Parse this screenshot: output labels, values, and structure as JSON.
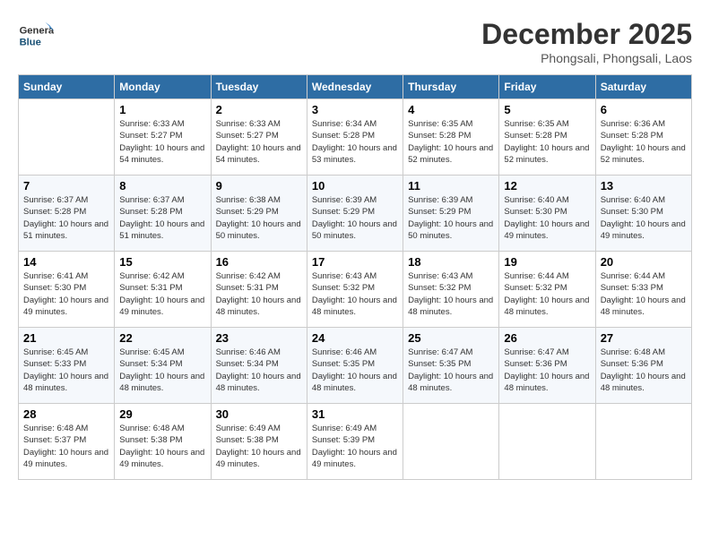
{
  "header": {
    "logo_general": "General",
    "logo_blue": "Blue",
    "month_title": "December 2025",
    "location": "Phongsali, Phongsali, Laos"
  },
  "days_of_week": [
    "Sunday",
    "Monday",
    "Tuesday",
    "Wednesday",
    "Thursday",
    "Friday",
    "Saturday"
  ],
  "weeks": [
    [
      {
        "day": "",
        "info": ""
      },
      {
        "day": "1",
        "info": "Sunrise: 6:33 AM\nSunset: 5:27 PM\nDaylight: 10 hours and 54 minutes."
      },
      {
        "day": "2",
        "info": "Sunrise: 6:33 AM\nSunset: 5:27 PM\nDaylight: 10 hours and 54 minutes."
      },
      {
        "day": "3",
        "info": "Sunrise: 6:34 AM\nSunset: 5:28 PM\nDaylight: 10 hours and 53 minutes."
      },
      {
        "day": "4",
        "info": "Sunrise: 6:35 AM\nSunset: 5:28 PM\nDaylight: 10 hours and 52 minutes."
      },
      {
        "day": "5",
        "info": "Sunrise: 6:35 AM\nSunset: 5:28 PM\nDaylight: 10 hours and 52 minutes."
      },
      {
        "day": "6",
        "info": "Sunrise: 6:36 AM\nSunset: 5:28 PM\nDaylight: 10 hours and 52 minutes."
      }
    ],
    [
      {
        "day": "7",
        "info": "Sunrise: 6:37 AM\nSunset: 5:28 PM\nDaylight: 10 hours and 51 minutes."
      },
      {
        "day": "8",
        "info": "Sunrise: 6:37 AM\nSunset: 5:28 PM\nDaylight: 10 hours and 51 minutes."
      },
      {
        "day": "9",
        "info": "Sunrise: 6:38 AM\nSunset: 5:29 PM\nDaylight: 10 hours and 50 minutes."
      },
      {
        "day": "10",
        "info": "Sunrise: 6:39 AM\nSunset: 5:29 PM\nDaylight: 10 hours and 50 minutes."
      },
      {
        "day": "11",
        "info": "Sunrise: 6:39 AM\nSunset: 5:29 PM\nDaylight: 10 hours and 50 minutes."
      },
      {
        "day": "12",
        "info": "Sunrise: 6:40 AM\nSunset: 5:30 PM\nDaylight: 10 hours and 49 minutes."
      },
      {
        "day": "13",
        "info": "Sunrise: 6:40 AM\nSunset: 5:30 PM\nDaylight: 10 hours and 49 minutes."
      }
    ],
    [
      {
        "day": "14",
        "info": "Sunrise: 6:41 AM\nSunset: 5:30 PM\nDaylight: 10 hours and 49 minutes."
      },
      {
        "day": "15",
        "info": "Sunrise: 6:42 AM\nSunset: 5:31 PM\nDaylight: 10 hours and 49 minutes."
      },
      {
        "day": "16",
        "info": "Sunrise: 6:42 AM\nSunset: 5:31 PM\nDaylight: 10 hours and 48 minutes."
      },
      {
        "day": "17",
        "info": "Sunrise: 6:43 AM\nSunset: 5:32 PM\nDaylight: 10 hours and 48 minutes."
      },
      {
        "day": "18",
        "info": "Sunrise: 6:43 AM\nSunset: 5:32 PM\nDaylight: 10 hours and 48 minutes."
      },
      {
        "day": "19",
        "info": "Sunrise: 6:44 AM\nSunset: 5:32 PM\nDaylight: 10 hours and 48 minutes."
      },
      {
        "day": "20",
        "info": "Sunrise: 6:44 AM\nSunset: 5:33 PM\nDaylight: 10 hours and 48 minutes."
      }
    ],
    [
      {
        "day": "21",
        "info": "Sunrise: 6:45 AM\nSunset: 5:33 PM\nDaylight: 10 hours and 48 minutes."
      },
      {
        "day": "22",
        "info": "Sunrise: 6:45 AM\nSunset: 5:34 PM\nDaylight: 10 hours and 48 minutes."
      },
      {
        "day": "23",
        "info": "Sunrise: 6:46 AM\nSunset: 5:34 PM\nDaylight: 10 hours and 48 minutes."
      },
      {
        "day": "24",
        "info": "Sunrise: 6:46 AM\nSunset: 5:35 PM\nDaylight: 10 hours and 48 minutes."
      },
      {
        "day": "25",
        "info": "Sunrise: 6:47 AM\nSunset: 5:35 PM\nDaylight: 10 hours and 48 minutes."
      },
      {
        "day": "26",
        "info": "Sunrise: 6:47 AM\nSunset: 5:36 PM\nDaylight: 10 hours and 48 minutes."
      },
      {
        "day": "27",
        "info": "Sunrise: 6:48 AM\nSunset: 5:36 PM\nDaylight: 10 hours and 48 minutes."
      }
    ],
    [
      {
        "day": "28",
        "info": "Sunrise: 6:48 AM\nSunset: 5:37 PM\nDaylight: 10 hours and 49 minutes."
      },
      {
        "day": "29",
        "info": "Sunrise: 6:48 AM\nSunset: 5:38 PM\nDaylight: 10 hours and 49 minutes."
      },
      {
        "day": "30",
        "info": "Sunrise: 6:49 AM\nSunset: 5:38 PM\nDaylight: 10 hours and 49 minutes."
      },
      {
        "day": "31",
        "info": "Sunrise: 6:49 AM\nSunset: 5:39 PM\nDaylight: 10 hours and 49 minutes."
      },
      {
        "day": "",
        "info": ""
      },
      {
        "day": "",
        "info": ""
      },
      {
        "day": "",
        "info": ""
      }
    ]
  ]
}
